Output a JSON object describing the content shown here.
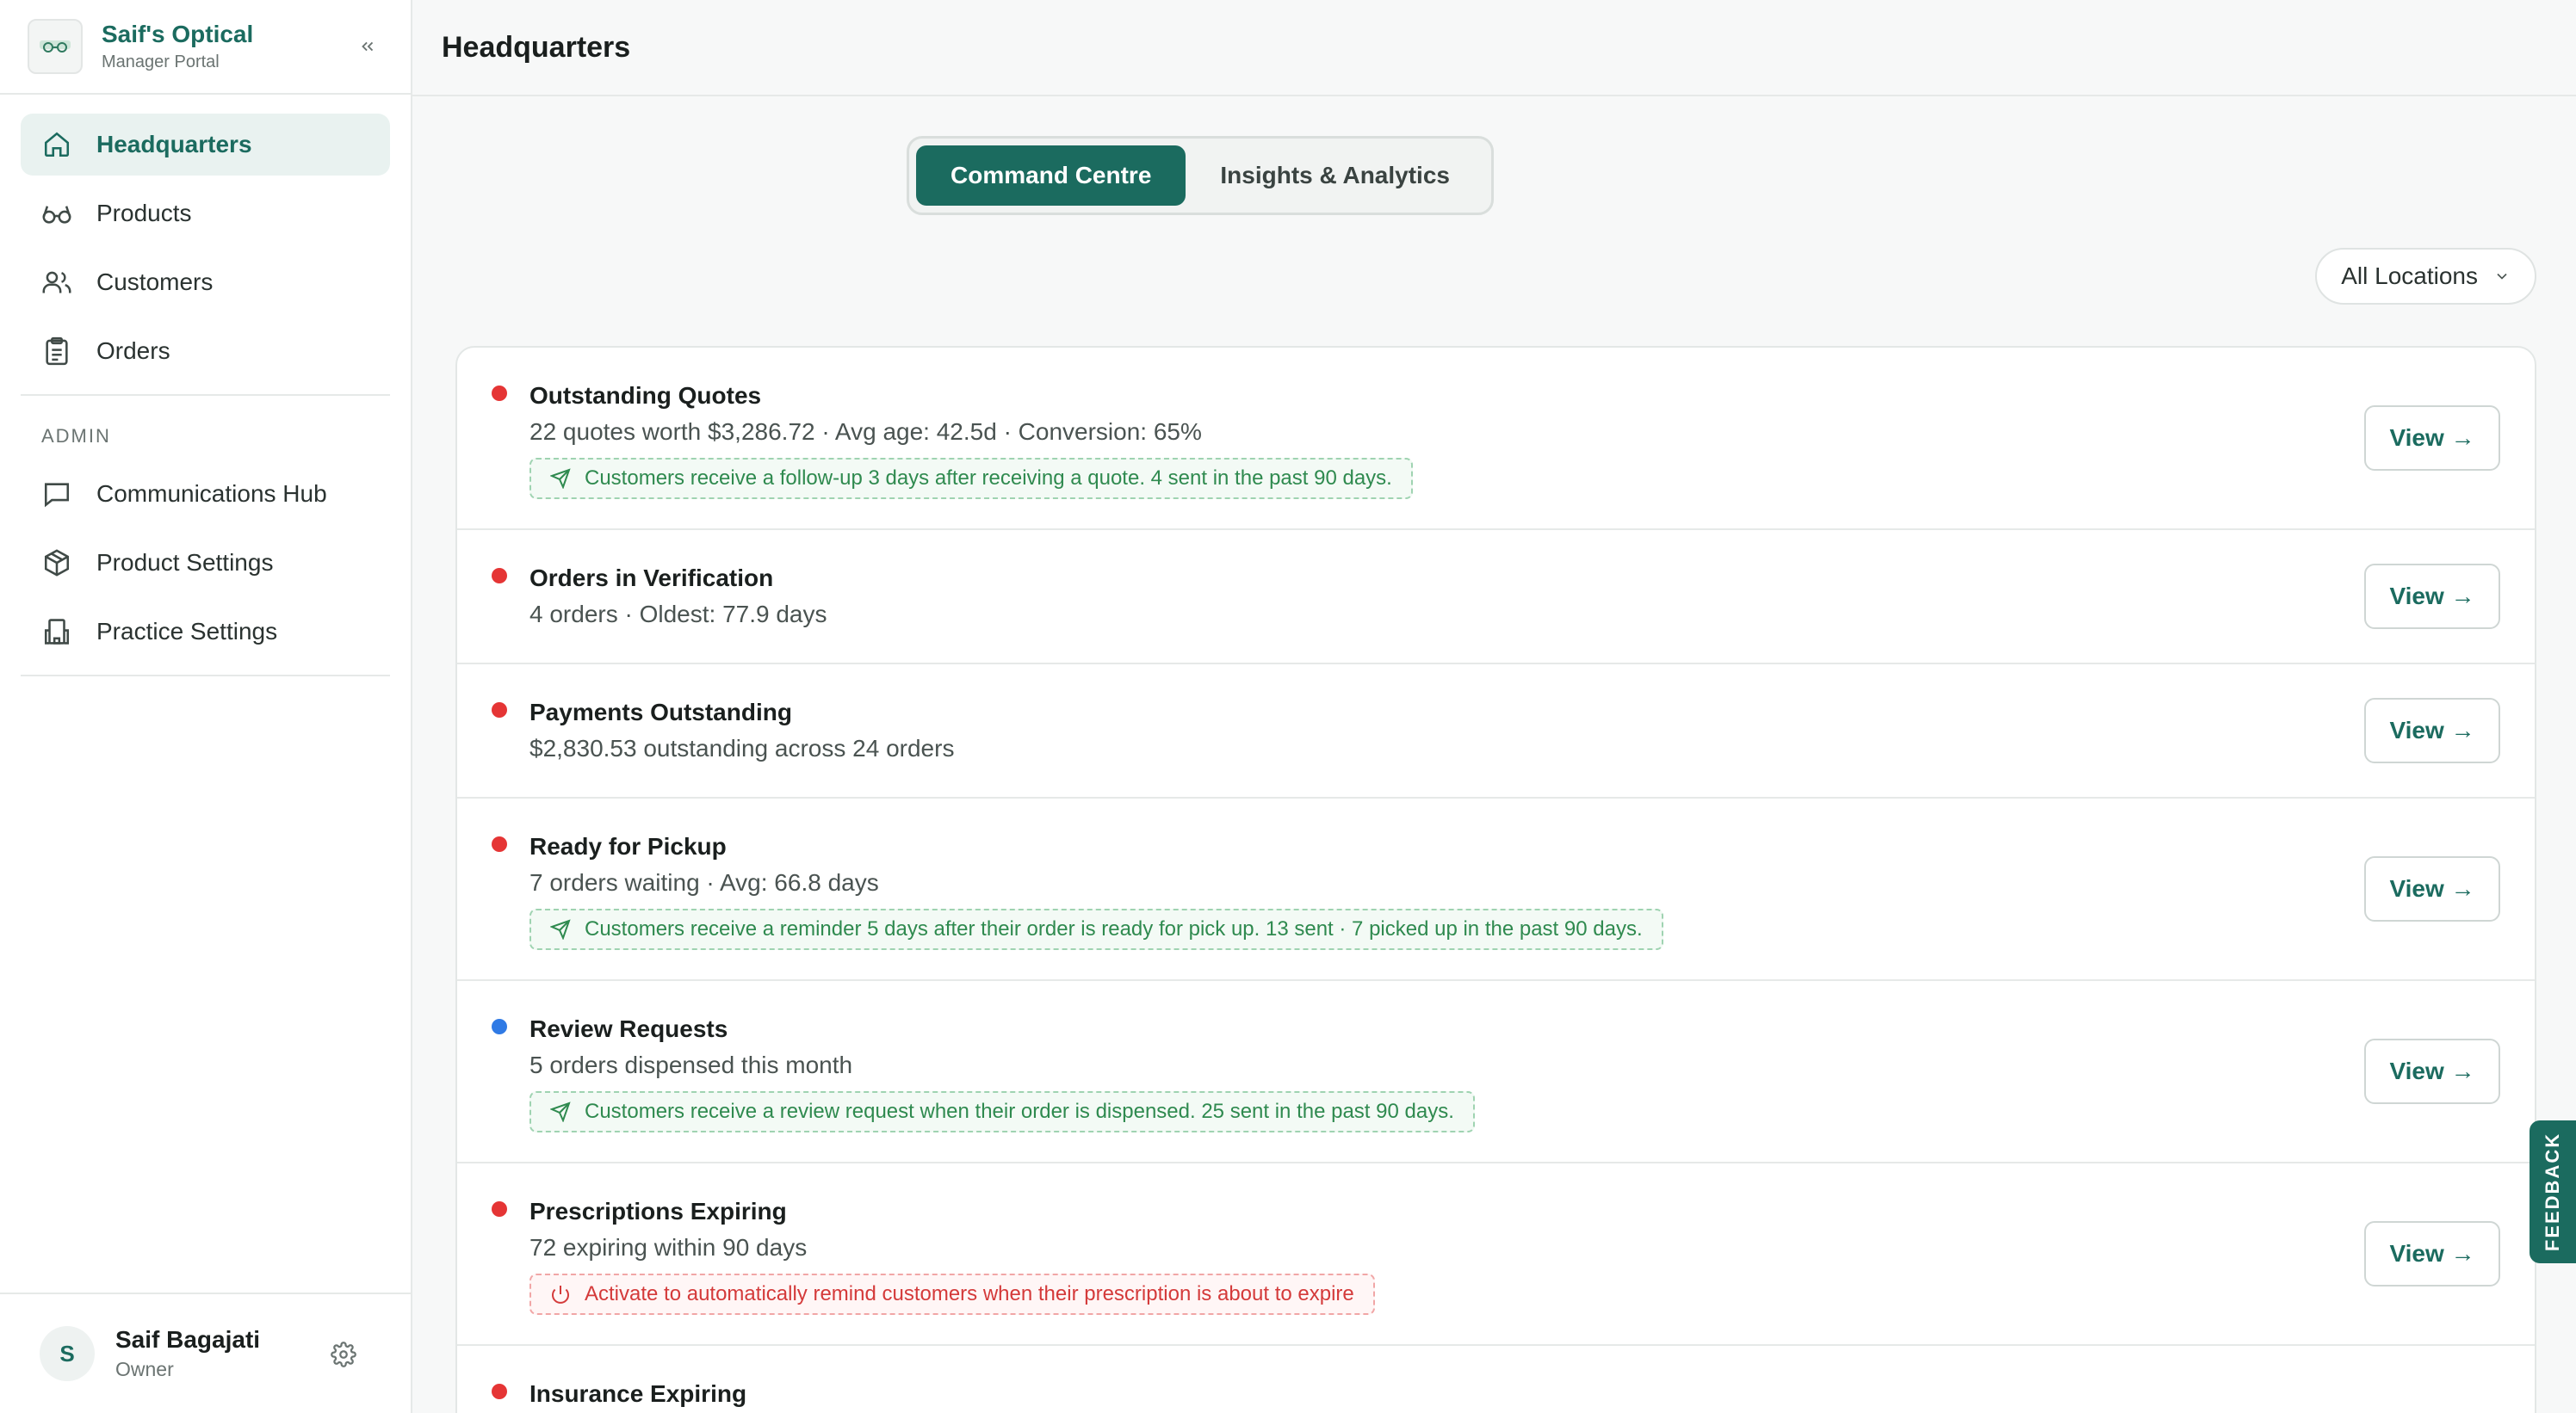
{
  "brand": {
    "name": "Saif's Optical",
    "subtitle": "Manager Portal"
  },
  "sidebar": {
    "items": [
      {
        "label": "Headquarters",
        "icon": "home-icon",
        "active": true
      },
      {
        "label": "Products",
        "icon": "glasses-icon",
        "active": false
      },
      {
        "label": "Customers",
        "icon": "users-icon",
        "active": false
      },
      {
        "label": "Orders",
        "icon": "clipboard-icon",
        "active": false
      }
    ],
    "admin_label": "ADMIN",
    "admin_items": [
      {
        "label": "Communications Hub",
        "icon": "message-icon"
      },
      {
        "label": "Product Settings",
        "icon": "package-icon"
      },
      {
        "label": "Practice Settings",
        "icon": "building-icon"
      }
    ]
  },
  "user": {
    "initial": "S",
    "name": "Saif Bagajati",
    "role": "Owner"
  },
  "header": {
    "title": "Headquarters"
  },
  "tabs": [
    {
      "label": "Command Centre",
      "active": true
    },
    {
      "label": "Insights & Analytics",
      "active": false
    }
  ],
  "location_filter": {
    "selected": "All Locations"
  },
  "colors": {
    "brand": "#1b6b5f",
    "status_red": "#e53535",
    "status_blue": "#2f7ae5",
    "success_green": "#2f8a4f"
  },
  "rows": [
    {
      "title": "Outstanding Quotes",
      "subtitle": "22 quotes worth $3,286.72 · Avg age: 42.5d · Conversion: 65%",
      "status": "red",
      "note": "Customers receive a follow-up 3 days after receiving a quote. 4 sent in the past 90 days.",
      "note_type": "success",
      "button": "View →"
    },
    {
      "title": "Orders in Verification",
      "subtitle": "4 orders · Oldest: 77.9 days",
      "status": "red",
      "button": "View →"
    },
    {
      "title": "Payments Outstanding",
      "subtitle": "$2,830.53 outstanding across 24 orders",
      "status": "red",
      "button": "View →"
    },
    {
      "title": "Ready for Pickup",
      "subtitle": "7 orders waiting · Avg: 66.8 days",
      "status": "red",
      "note": "Customers receive a reminder 5 days after their order is ready for pick up. 13 sent · 7 picked up in the past 90 days.",
      "note_type": "success",
      "button": "View →"
    },
    {
      "title": "Review Requests",
      "subtitle": "5 orders dispensed this month",
      "status": "blue",
      "note": "Customers receive a review request when their order is dispensed. 25 sent in the past 90 days.",
      "note_type": "success",
      "button": "View →"
    },
    {
      "title": "Prescriptions Expiring",
      "subtitle": "72 expiring within 90 days",
      "status": "red",
      "note": "Activate to automatically remind customers when their prescription is about to expire",
      "note_type": "danger",
      "button": "View →"
    },
    {
      "title": "Insurance Expiring",
      "status": "red"
    }
  ],
  "feedback_label": "FEEDBACK"
}
